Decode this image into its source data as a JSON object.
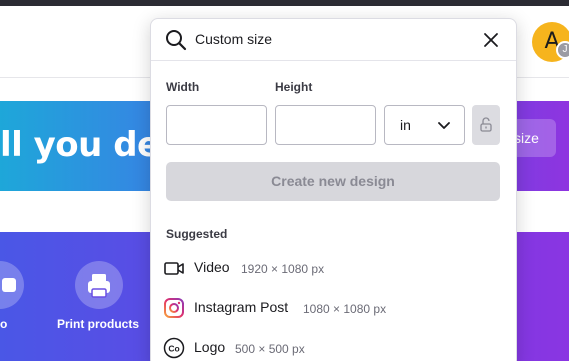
{
  "header": {
    "avatar_initial": "A",
    "avatar_badge": "J"
  },
  "hero": {
    "headline": "ll you des",
    "button_label": "size"
  },
  "categories": [
    {
      "label": "o"
    },
    {
      "label": "Print products"
    }
  ],
  "resize_panel": {
    "search": {
      "value": "Custom size"
    },
    "width_label": "Width",
    "height_label": "Height",
    "width_value": "",
    "height_value": "",
    "unit": "in",
    "create_label": "Create new design",
    "suggested_title": "Suggested",
    "suggestions": [
      {
        "name": "Video",
        "dims": "1920 × 1080 px",
        "icon": "video-camera-icon"
      },
      {
        "name": "Instagram Post",
        "dims": "1080 × 1080 px",
        "icon": "instagram-icon"
      },
      {
        "name": "Logo",
        "dims": "500 × 500 px",
        "icon": "logo-badge-icon"
      }
    ]
  },
  "colors": {
    "accent_purple": "#7d2ae8",
    "hero_start": "#1ea7d9",
    "hero_end": "#8e34e0",
    "avatar": "#f6b41d",
    "instagram": "#e1306c"
  }
}
